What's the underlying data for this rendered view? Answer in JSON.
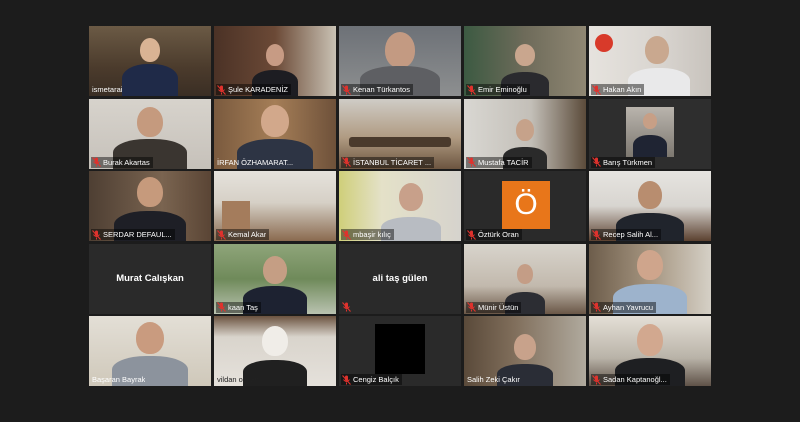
{
  "participants": [
    {
      "name": "ismetarai",
      "muted": false
    },
    {
      "name": "Şule KARADENİZ",
      "muted": true
    },
    {
      "name": "Kenan Türkantos",
      "muted": true
    },
    {
      "name": "Emir Eminoğlu",
      "muted": true
    },
    {
      "name": "Hakan Akın",
      "muted": true
    },
    {
      "name": "Burak Akartas",
      "muted": true
    },
    {
      "name": "İRFAN ÖZHAMARAT...",
      "muted": false
    },
    {
      "name": "İSTANBUL TİCARET ...",
      "muted": true
    },
    {
      "name": "Mustafa TACİR",
      "muted": true
    },
    {
      "name": "Barış Türkmen",
      "muted": true
    },
    {
      "name": "SERDAR DEFAUL...",
      "muted": true
    },
    {
      "name": "Kemal Akar",
      "muted": true
    },
    {
      "name": "mbaşir kılıç",
      "muted": true
    },
    {
      "name": "Öztürk Oran",
      "muted": true
    },
    {
      "name": "Recep Salih Al...",
      "muted": true
    },
    {
      "name": "Murat Calışkan",
      "muted": true
    },
    {
      "name": "kaan Taş",
      "muted": true
    },
    {
      "name": "ali taş gülen",
      "muted": true
    },
    {
      "name": "Münir Üstün",
      "muted": true
    },
    {
      "name": "Ayhan Yavrucu",
      "muted": true
    },
    {
      "name": "Başaran Bayrak",
      "muted": false
    },
    {
      "name": "vildan ozcan",
      "muted": false
    },
    {
      "name": "Cengiz Balçık",
      "muted": true
    },
    {
      "name": "Salih Zeki Çakır",
      "muted": false
    },
    {
      "name": "Sadan Kaptanoğl...",
      "muted": true
    }
  ],
  "center_names": {
    "murat": "Murat Calışkan",
    "ali": "ali taş gülen"
  },
  "avatar_letter": "Ö",
  "colors": {
    "background": "#1c1c1c",
    "active_speaker": "#9be34a",
    "muted_icon": "#e0322d",
    "avatar_orange": "#e8761a"
  }
}
